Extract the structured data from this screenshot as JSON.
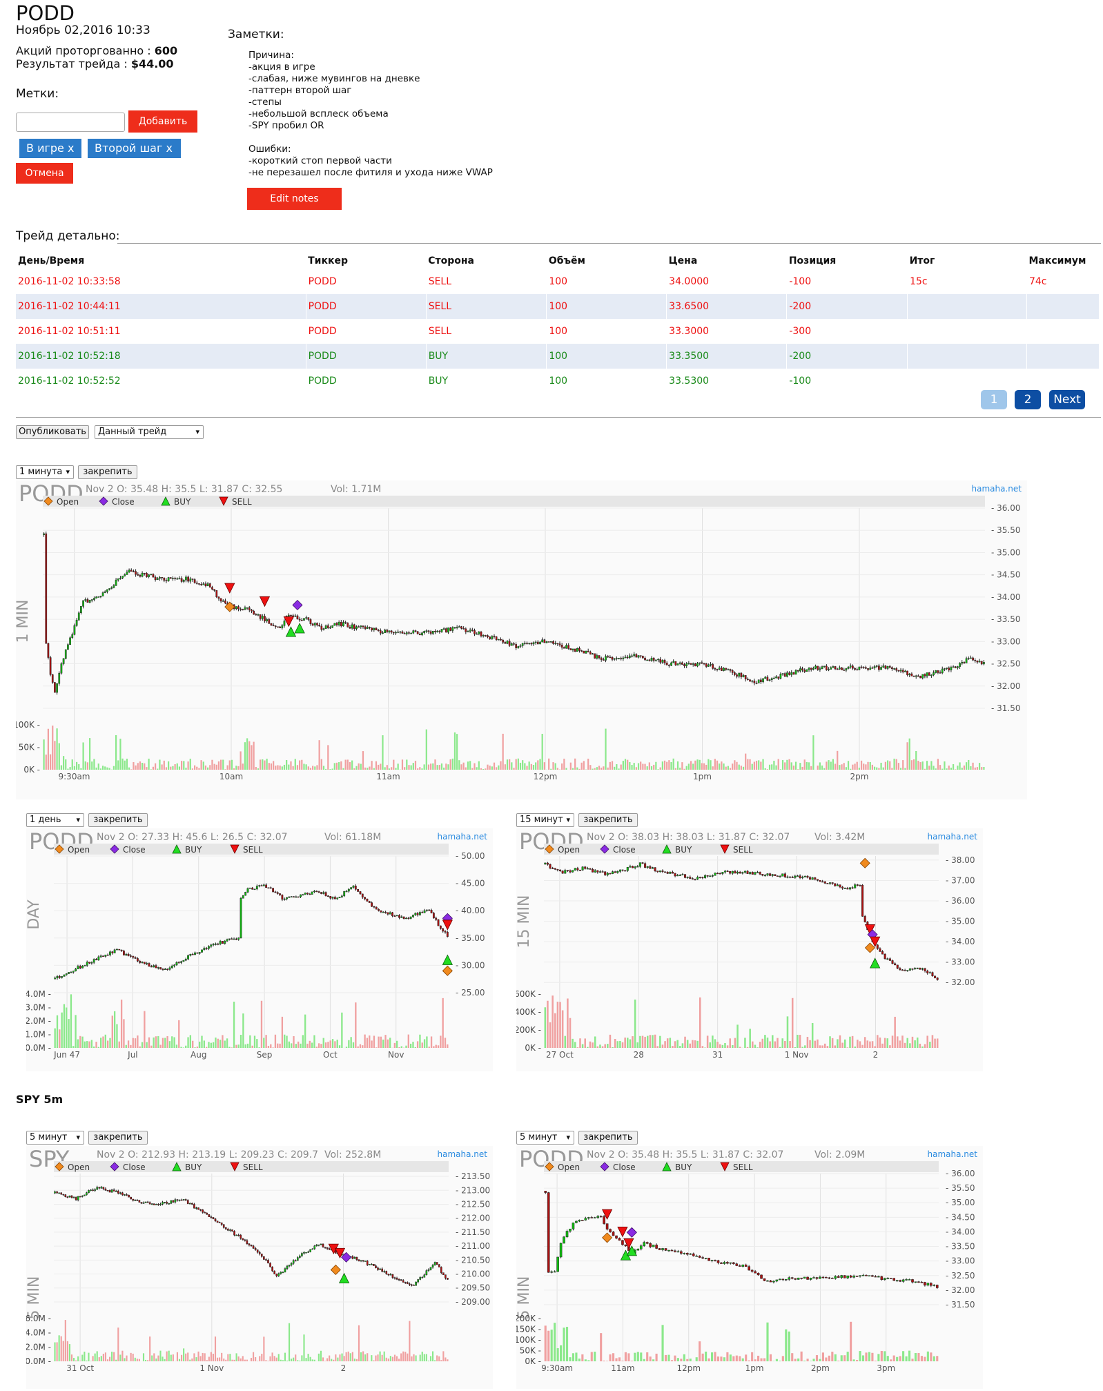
{
  "trade": {
    "ticker": "PODD",
    "datetime": "Ноябрь 02,2016 10:33",
    "shares_label": "Акций проторгованно :",
    "shares_value": "600",
    "result_label": "Результат трейда :",
    "result_value": "$44.00"
  },
  "tags": {
    "title": "Метки:",
    "add_button": "Добавить",
    "items": [
      "В игре x",
      "Второй шаг x"
    ],
    "cancel_button": "Отмена"
  },
  "notes": {
    "title": "Заметки:",
    "text": "Причина:\n-акция в игре\n-слабая, ниже мувингов на дневке\n-паттерн второй шаг\n-степы\n-небольшой всплеск объема\n-SPY пробил OR\n\nОшибки:\n-короткий стоп первой части\n-не перезашел после фитиля и ухода ниже VWAP",
    "edit_button": "Edit notes"
  },
  "details": {
    "title": "Трейд детально:",
    "columns": [
      "День/Время",
      "Тиккер",
      "Сторона",
      "Объём",
      "Цена",
      "Позиция",
      "Итог",
      "Максимум"
    ],
    "rows": [
      [
        "2016-11-02 10:33:58",
        "PODD",
        "SELL",
        "100",
        "34.0000",
        "-100",
        "15c",
        "74c"
      ],
      [
        "2016-11-02 10:44:11",
        "PODD",
        "SELL",
        "100",
        "33.6500",
        "-200",
        "",
        ""
      ],
      [
        "2016-11-02 10:51:11",
        "PODD",
        "SELL",
        "100",
        "33.3000",
        "-300",
        "",
        ""
      ],
      [
        "2016-11-02 10:52:18",
        "PODD",
        "BUY",
        "100",
        "33.3500",
        "-200",
        "",
        ""
      ],
      [
        "2016-11-02 10:52:52",
        "PODD",
        "BUY",
        "100",
        "33.5300",
        "-100",
        "",
        ""
      ]
    ],
    "pagination": [
      "1",
      "2",
      "Next"
    ]
  },
  "publish": {
    "button": "Опубликовать",
    "select": "Данный трейд"
  },
  "pin_label": "закрепить",
  "spy_title": "SPY 5m",
  "legend": [
    "Open",
    "Close",
    "BUY",
    "SELL"
  ],
  "colors": {
    "accent_red": "#ee2d1b",
    "tag_blue": "#2b7bc9",
    "sell": "#e11111",
    "buy": "#1a8a1a",
    "row_alt": "#e5ebf5",
    "up": "#11bb11",
    "down": "#aa1111"
  },
  "chart_data": [
    {
      "type": "candlestick",
      "interval_select": "1 минута",
      "symbol": "PODD",
      "title": "Nov 2 O: 35.48 H: 35.5 L: 31.87 C: 32.55",
      "vol": "Vol: 1.71M",
      "watermark": "hamaha.net",
      "side_label": "1 MIN",
      "y_ticks": [
        "36.00",
        "35.50",
        "35.00",
        "34.50",
        "34.00",
        "33.50",
        "33.00",
        "32.50",
        "32.00",
        "31.50"
      ],
      "ylim": [
        31.5,
        36.0
      ],
      "vol_ticks": [
        "100K",
        "50K",
        "0K"
      ],
      "x_ticks": [
        "9:30am",
        "10am",
        "11am",
        "12pm",
        "1pm",
        "2pm"
      ],
      "anchors": [
        [
          0,
          35.4
        ],
        [
          1,
          33.0
        ],
        [
          3,
          32.3
        ],
        [
          5,
          31.9
        ],
        [
          8,
          32.5
        ],
        [
          13,
          33.2
        ],
        [
          18,
          33.9
        ],
        [
          25,
          34.0
        ],
        [
          32,
          34.3
        ],
        [
          38,
          34.6
        ],
        [
          45,
          34.5
        ],
        [
          55,
          34.4
        ],
        [
          65,
          34.4
        ],
        [
          74,
          34.3
        ],
        [
          78,
          34.1
        ],
        [
          84,
          33.8
        ],
        [
          94,
          33.7
        ],
        [
          101,
          33.5
        ],
        [
          108,
          33.3
        ],
        [
          112,
          33.6
        ],
        [
          120,
          33.5
        ],
        [
          127,
          33.3
        ],
        [
          135,
          33.4
        ],
        [
          145,
          33.3
        ],
        [
          158,
          33.2
        ],
        [
          175,
          33.2
        ],
        [
          190,
          33.3
        ],
        [
          205,
          33.1
        ],
        [
          215,
          32.9
        ],
        [
          230,
          33.0
        ],
        [
          245,
          32.8
        ],
        [
          255,
          32.6
        ],
        [
          270,
          32.7
        ],
        [
          285,
          32.5
        ],
        [
          300,
          32.5
        ],
        [
          315,
          32.3
        ],
        [
          325,
          32.1
        ],
        [
          335,
          32.2
        ],
        [
          350,
          32.4
        ],
        [
          370,
          32.4
        ],
        [
          390,
          32.4
        ],
        [
          400,
          32.2
        ],
        [
          415,
          32.4
        ],
        [
          423,
          32.6
        ],
        [
          430,
          32.5
        ]
      ],
      "n_bars": 431,
      "markers": [
        {
          "k": "SELL",
          "x": 85,
          "y": 34.2
        },
        {
          "k": "Open",
          "x": 85,
          "y": 33.78
        },
        {
          "k": "SELL",
          "x": 101,
          "y": 33.9
        },
        {
          "k": "SELL",
          "x": 112,
          "y": 33.45
        },
        {
          "k": "Close",
          "x": 116,
          "y": 33.82
        },
        {
          "k": "BUY",
          "x": 113,
          "y": 33.22
        },
        {
          "k": "BUY",
          "x": 117,
          "y": 33.3
        }
      ]
    },
    {
      "type": "candlestick",
      "interval_select": "1 день",
      "symbol": "PODD",
      "title": "Nov 2 O: 27.33 H: 45.6 L: 26.5 C: 32.07",
      "vol": "Vol: 61.18M",
      "watermark": "hamaha.net",
      "side_label": "DAY",
      "y_ticks": [
        "50.00",
        "45.00",
        "40.00",
        "35.00",
        "30.00",
        "25.00"
      ],
      "ylim": [
        25.0,
        50.0
      ],
      "vol_ticks": [
        "4.0M",
        "3.0M",
        "2.0M",
        "1.0M",
        "0.0M"
      ],
      "x_ticks": [
        "Jun 47",
        "Jul",
        "Aug",
        "Sep",
        "Oct",
        "Nov"
      ],
      "anchors": [
        [
          0,
          27.5
        ],
        [
          5,
          28.5
        ],
        [
          12,
          30
        ],
        [
          20,
          31.5
        ],
        [
          27,
          32.8
        ],
        [
          33,
          31.5
        ],
        [
          40,
          30.2
        ],
        [
          47,
          29.0
        ],
        [
          53,
          30.5
        ],
        [
          60,
          32
        ],
        [
          67,
          33.5
        ],
        [
          75,
          34.5
        ],
        [
          80,
          35.0
        ],
        [
          81,
          42.5
        ],
        [
          84,
          44
        ],
        [
          92,
          44.5
        ],
        [
          100,
          42
        ],
        [
          108,
          43
        ],
        [
          115,
          43.5
        ],
        [
          122,
          42
        ],
        [
          130,
          44.5
        ],
        [
          135,
          42
        ],
        [
          140,
          40
        ],
        [
          146,
          39.5
        ],
        [
          152,
          38.5
        ],
        [
          158,
          39.5
        ],
        [
          163,
          40
        ],
        [
          167,
          37.5
        ],
        [
          171,
          35.5
        ]
      ],
      "n_bars": 172,
      "markers": [
        {
          "k": "Close",
          "x": 171,
          "y": 38.6
        },
        {
          "k": "SELL",
          "x": 171,
          "y": 37.4
        },
        {
          "k": "BUY",
          "x": 171,
          "y": 31.0
        },
        {
          "k": "Open",
          "x": 171,
          "y": 29.0
        }
      ]
    },
    {
      "type": "candlestick",
      "interval_select": "15 минут",
      "symbol": "PODD",
      "title": "Nov 2 O: 38.03 H: 38.03 L: 31.87 C: 32.07",
      "vol": "Vol: 3.42M",
      "watermark": "hamaha.net",
      "side_label": "15 MIN",
      "y_ticks": [
        "38.00",
        "37.00",
        "36.00",
        "35.00",
        "34.00",
        "33.00",
        "32.00"
      ],
      "ylim": [
        31.5,
        38.2
      ],
      "vol_ticks": [
        "600K",
        "400K",
        "200K",
        "0K"
      ],
      "x_ticks": [
        "27 Oct",
        "28",
        "31",
        "1 Nov",
        "2"
      ],
      "anchors": [
        [
          0,
          37.8
        ],
        [
          6,
          37.4
        ],
        [
          15,
          37.6
        ],
        [
          25,
          37.3
        ],
        [
          33,
          37.6
        ],
        [
          38,
          37.8
        ],
        [
          45,
          37.5
        ],
        [
          52,
          37.3
        ],
        [
          60,
          37.1
        ],
        [
          70,
          37.4
        ],
        [
          80,
          37.4
        ],
        [
          90,
          37.3
        ],
        [
          100,
          37.2
        ],
        [
          108,
          37.1
        ],
        [
          115,
          36.8
        ],
        [
          120,
          36.6
        ],
        [
          126,
          36.8
        ],
        [
          127,
          35.2
        ],
        [
          131,
          34.0
        ],
        [
          136,
          33.2
        ],
        [
          142,
          32.6
        ],
        [
          150,
          32.7
        ],
        [
          157,
          32.2
        ]
      ],
      "n_bars": 158,
      "markers": [
        {
          "k": "Open",
          "x": 128,
          "y": 37.85
        },
        {
          "k": "SELL",
          "x": 130,
          "y": 34.6
        },
        {
          "k": "Close",
          "x": 131,
          "y": 34.35
        },
        {
          "k": "SELL",
          "x": 132,
          "y": 34.0
        },
        {
          "k": "Open",
          "x": 130,
          "y": 33.7
        },
        {
          "k": "BUY",
          "x": 132,
          "y": 32.95
        }
      ]
    },
    {
      "type": "candlestick",
      "interval_select": "5 минут",
      "symbol": "SPY",
      "title": "Nov 2 O: 212.93 H: 213.19 L: 209.23 C: 209.7",
      "vol": "Vol: 252.8M",
      "watermark": "hamaha.net",
      "side_label": "5 MIN",
      "y_ticks": [
        "213.50",
        "213.00",
        "212.50",
        "212.00",
        "211.50",
        "211.00",
        "210.50",
        "210.00",
        "209.50",
        "209.00"
      ],
      "ylim": [
        208.9,
        213.6
      ],
      "vol_ticks": [
        "6.0M",
        "4.0M",
        "2.0M",
        "0.0M"
      ],
      "x_ticks": [
        "31 Oct",
        "1 Nov",
        "2"
      ],
      "anchors": [
        [
          0,
          212.9
        ],
        [
          10,
          212.7
        ],
        [
          20,
          213.1
        ],
        [
          30,
          212.9
        ],
        [
          40,
          212.6
        ],
        [
          50,
          212.5
        ],
        [
          60,
          212.7
        ],
        [
          70,
          212.2
        ],
        [
          80,
          211.7
        ],
        [
          90,
          211.2
        ],
        [
          100,
          210.5
        ],
        [
          105,
          209.9
        ],
        [
          115,
          210.6
        ],
        [
          125,
          211.1
        ],
        [
          135,
          210.7
        ],
        [
          145,
          210.5
        ],
        [
          155,
          210.1
        ],
        [
          165,
          209.7
        ],
        [
          170,
          209.6
        ],
        [
          180,
          210.4
        ],
        [
          186,
          209.8
        ]
      ],
      "n_bars": 187,
      "markers": [
        {
          "k": "SELL",
          "x": 132,
          "y": 210.9
        },
        {
          "k": "SELL",
          "x": 135,
          "y": 210.75
        },
        {
          "k": "Close",
          "x": 138,
          "y": 210.6
        },
        {
          "k": "Open",
          "x": 133,
          "y": 210.15
        },
        {
          "k": "BUY",
          "x": 137,
          "y": 209.85
        }
      ]
    },
    {
      "type": "candlestick",
      "interval_select": "5 минут",
      "symbol": "PODD",
      "title": "Nov 2 O: 35.48 H: 35.5 L: 31.87 C: 32.07",
      "vol": "Vol: 2.09M",
      "watermark": "hamaha.net",
      "side_label": "5 MIN",
      "y_ticks": [
        "36.00",
        "35.50",
        "35.00",
        "34.50",
        "34.00",
        "33.50",
        "33.00",
        "32.50",
        "32.00",
        "31.50"
      ],
      "ylim": [
        31.5,
        36.0
      ],
      "vol_ticks": [
        "200K",
        "150K",
        "100K",
        "50K",
        "0K"
      ],
      "x_ticks": [
        "9:30am",
        "11am",
        "12pm",
        "1pm",
        "2pm",
        "3pm"
      ],
      "anchors": [
        [
          0,
          35.4
        ],
        [
          1,
          32.6
        ],
        [
          3,
          32.6
        ],
        [
          5,
          33.6
        ],
        [
          7,
          34.0
        ],
        [
          10,
          34.4
        ],
        [
          14,
          34.5
        ],
        [
          18,
          34.5
        ],
        [
          20,
          34.1
        ],
        [
          24,
          33.7
        ],
        [
          28,
          33.3
        ],
        [
          32,
          33.6
        ],
        [
          38,
          33.4
        ],
        [
          45,
          33.3
        ],
        [
          55,
          33.0
        ],
        [
          65,
          32.8
        ],
        [
          72,
          32.3
        ],
        [
          80,
          32.4
        ],
        [
          90,
          32.4
        ],
        [
          100,
          32.5
        ],
        [
          110,
          32.4
        ],
        [
          120,
          32.3
        ],
        [
          127,
          32.1
        ]
      ],
      "n_bars": 128,
      "markers": [
        {
          "k": "SELL",
          "x": 20,
          "y": 34.6
        },
        {
          "k": "Open",
          "x": 20,
          "y": 33.8
        },
        {
          "k": "SELL",
          "x": 25,
          "y": 34.0
        },
        {
          "k": "SELL",
          "x": 27,
          "y": 33.6
        },
        {
          "k": "Close",
          "x": 28,
          "y": 33.98
        },
        {
          "k": "BUY",
          "x": 26,
          "y": 33.2
        },
        {
          "k": "BUY",
          "x": 28,
          "y": 33.35
        }
      ]
    }
  ]
}
